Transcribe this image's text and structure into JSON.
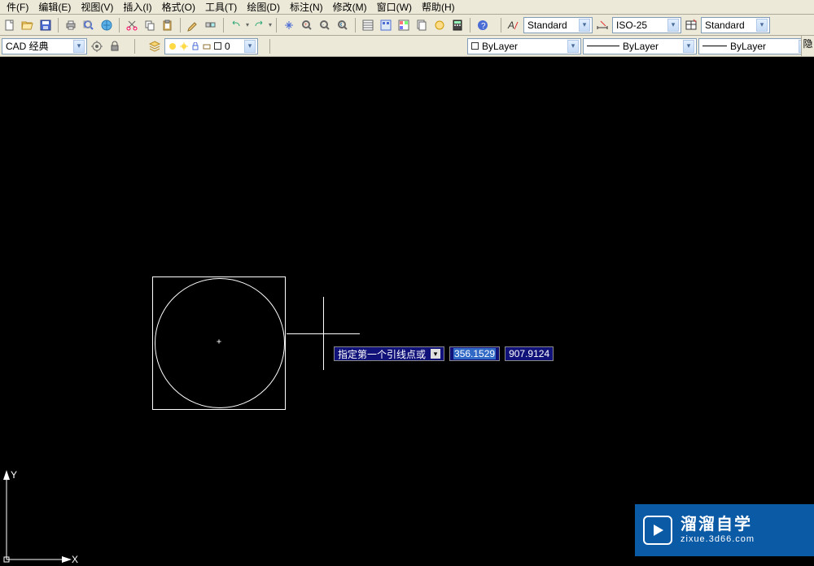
{
  "menu": {
    "file": "件(F)",
    "edit": "编辑(E)",
    "view": "视图(V)",
    "insert": "插入(I)",
    "format": "格式(O)",
    "tools": "工具(T)",
    "draw": "绘图(D)",
    "dimension": "标注(N)",
    "modify": "修改(M)",
    "window": "窗口(W)",
    "help": "帮助(H)"
  },
  "workspace": "CAD 经典",
  "layer": {
    "value": "0"
  },
  "bylayer": {
    "color_label": "ByLayer",
    "line_label": "ByLayer",
    "lw_label": "ByLayer"
  },
  "styles": {
    "text_style": "Standard",
    "dim_style": "ISO-25",
    "table_style": "Standard"
  },
  "dyn": {
    "prompt": "指定第一个引线点或",
    "coord_x": "356.1529",
    "coord_y": "907.9124"
  },
  "ucs": {
    "x": "X",
    "y": "Y"
  },
  "watermark": {
    "brand": "溜溜自学",
    "url": "zixue.3d66.com"
  },
  "right_clip": "隐"
}
